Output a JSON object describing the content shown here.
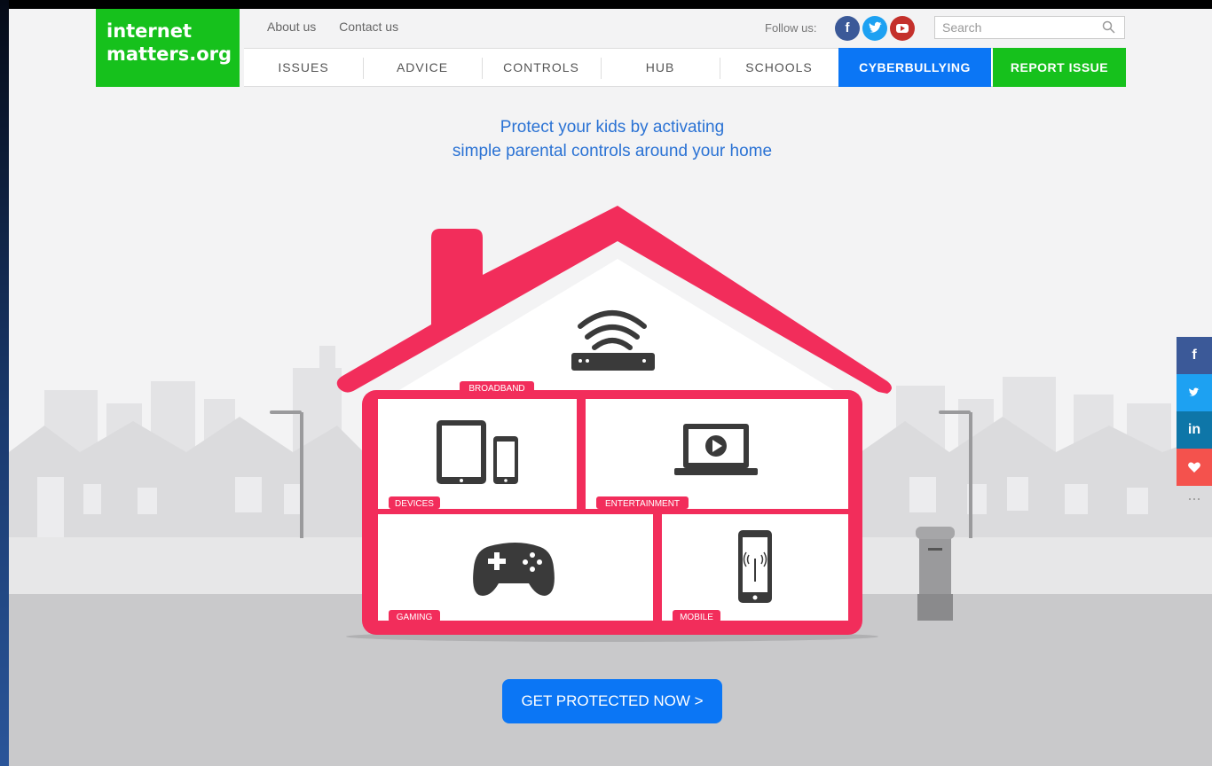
{
  "logo": {
    "line1": "internet",
    "line2": "matters.org"
  },
  "topnav": {
    "about": "About us",
    "contact": "Contact us"
  },
  "follow": {
    "label": "Follow us:",
    "facebook_icon": "f",
    "twitter_icon": "twitter-bird",
    "youtube_icon": "play"
  },
  "search": {
    "placeholder": "Search"
  },
  "nav": {
    "items": [
      "ISSUES",
      "ADVICE",
      "CONTROLS",
      "HUB",
      "SCHOOLS"
    ],
    "cyberbullying": "CYBERBULLYING",
    "report": "REPORT ISSUE"
  },
  "hero": {
    "line1": "Protect your kids by activating",
    "line2": "simple parental controls around your home"
  },
  "rooms": {
    "broadband": "BROADBAND",
    "devices": "DEVICES",
    "entertainment": "ENTERTAINMENT",
    "gaming": "GAMING",
    "mobile": "MOBILE"
  },
  "cta": {
    "label": "GET PROTECTED NOW >"
  },
  "share": {
    "facebook": "f",
    "linkedin": "in",
    "more": "..."
  },
  "colors": {
    "brand_green": "#16c11c",
    "brand_blue": "#0b76f5",
    "house_pink": "#f22d5b",
    "icon_dark": "#3a3a3a"
  }
}
